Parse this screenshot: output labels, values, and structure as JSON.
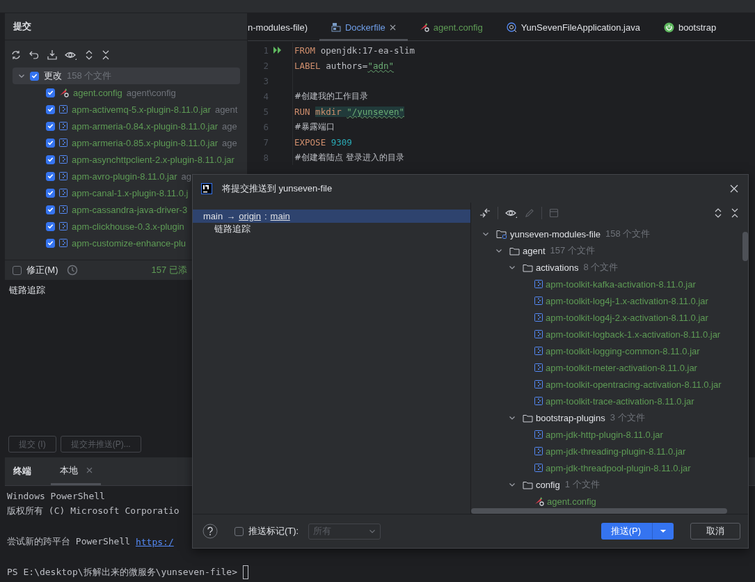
{
  "commit_panel": {
    "title": "提交",
    "changes": {
      "label": "更改",
      "count": "158 个文件",
      "checked": true,
      "expanded": true,
      "files": [
        {
          "name": "agent.config",
          "path": "agent\\config",
          "kind": "config",
          "checked": true
        },
        {
          "name": "apm-activemq-5.x-plugin-8.11.0.jar",
          "path": "agent",
          "kind": "jar",
          "checked": true
        },
        {
          "name": "apm-armeria-0.84.x-plugin-8.11.0.jar",
          "path": "age",
          "kind": "jar",
          "checked": true
        },
        {
          "name": "apm-armeria-0.85.x-plugin-8.11.0.jar",
          "path": "age",
          "kind": "jar",
          "checked": true
        },
        {
          "name": "apm-asynchttpclient-2.x-plugin-8.11.0.jar",
          "kind": "jar",
          "checked": true
        },
        {
          "name": "apm-avro-plugin-8.11.0.jar",
          "path": "ag",
          "kind": "jar",
          "checked": true
        },
        {
          "name": "apm-canal-1.x-plugin-8.11.0.j",
          "kind": "jar",
          "checked": true
        },
        {
          "name": "apm-cassandra-java-driver-3",
          "kind": "jar",
          "checked": true
        },
        {
          "name": "apm-clickhouse-0.3.x-plugin",
          "kind": "jar",
          "checked": true
        },
        {
          "name": "apm-customize-enhance-plu",
          "kind": "jar",
          "checked": true
        }
      ]
    },
    "amend": {
      "label": "修正(M)",
      "checked": false
    },
    "added_note": "157 已添",
    "message": "链路追踪",
    "buttons": [
      {
        "label": "提交 (I)",
        "disabled": true
      },
      {
        "label": "提交并推送(P)...",
        "disabled": true
      }
    ]
  },
  "editor": {
    "tabs": [
      {
        "label": "n-modules-file)",
        "kind": "partial",
        "color": "#dfe1e5",
        "selected": false
      },
      {
        "label": "Dockerfile",
        "kind": "docker",
        "color": "#6f9ee8",
        "selected": true,
        "closable": true
      },
      {
        "label": "agent.config",
        "kind": "config",
        "color": "#5e9b55",
        "selected": false
      },
      {
        "label": "YunSevenFileApplication.java",
        "kind": "java",
        "color": "#dfe1e5",
        "selected": false
      },
      {
        "label": "bootstrap",
        "kind": "spring",
        "color": "#dfe1e5",
        "selected": false
      }
    ],
    "lines": [
      {
        "number": "1",
        "run": true,
        "tokens": [
          {
            "kind": "keyword",
            "text": "FROM "
          },
          {
            "kind": "plain",
            "text": "openjdk:17-ea-slim"
          }
        ]
      },
      {
        "number": "2",
        "tokens": [
          {
            "kind": "keyword",
            "text": "LABEL "
          },
          {
            "kind": "plain",
            "text": "authors="
          },
          {
            "kind": "string",
            "text": "\"adn\""
          }
        ]
      },
      {
        "number": "3"
      },
      {
        "number": "4",
        "tokens": [
          {
            "kind": "comment",
            "text": "#创建我的工作目录"
          }
        ]
      },
      {
        "number": "5",
        "highlight": true,
        "tokens": [
          {
            "kind": "keyword",
            "text": "RUN "
          },
          {
            "kind": "command",
            "text": "mkdir "
          },
          {
            "kind": "string",
            "text": "\"/yunseven\""
          }
        ]
      },
      {
        "number": "6",
        "tokens": [
          {
            "kind": "comment",
            "text": "#暴露端口"
          }
        ]
      },
      {
        "number": "7",
        "tokens": [
          {
            "kind": "keyword",
            "text": "EXPOSE "
          },
          {
            "kind": "number",
            "text": "9309"
          }
        ]
      },
      {
        "number": "8",
        "tokens": [
          {
            "kind": "comment",
            "text": "#创建着陆点 登录进入的目录"
          }
        ]
      }
    ]
  },
  "terminal": {
    "title": "终端",
    "tabs": [
      {
        "label": "本地",
        "selected": true,
        "closable": true
      }
    ],
    "lines": [
      {
        "kind": "text",
        "text": "Windows PowerShell"
      },
      {
        "kind": "text",
        "text": "版权所有 (C) Microsoft Corporatio"
      },
      {
        "kind": "blank"
      },
      {
        "kind": "text",
        "text": "尝试新的跨平台 PowerShell ",
        "link": "https:/"
      },
      {
        "kind": "blank"
      },
      {
        "kind": "prompt",
        "text": "PS E:\\desktop\\拆解出来的微服务\\yunseven-file>"
      }
    ]
  },
  "push_dialog": {
    "title": "将提交推送到 yunseven-file",
    "pushes": [
      {
        "local": "main",
        "arrow": "→",
        "remote": "origin",
        "separator": ":",
        "branch": "main",
        "selected": true,
        "commits": [
          "链路追踪"
        ]
      }
    ],
    "tree": [
      {
        "name": "yunseven-modules-file",
        "count": "158 个文件",
        "kind": "module",
        "expanded": true,
        "children": [
          {
            "name": "agent",
            "count": "157 个文件",
            "kind": "folder",
            "expanded": true,
            "children": [
              {
                "name": "activations",
                "count": "8 个文件",
                "kind": "folder",
                "expanded": true,
                "children": [
                  {
                    "name": "apm-toolkit-kafka-activation-8.11.0.jar",
                    "kind": "jar"
                  },
                  {
                    "name": "apm-toolkit-log4j-1.x-activation-8.11.0.jar",
                    "kind": "jar"
                  },
                  {
                    "name": "apm-toolkit-log4j-2.x-activation-8.11.0.jar",
                    "kind": "jar"
                  },
                  {
                    "name": "apm-toolkit-logback-1.x-activation-8.11.0.jar",
                    "kind": "jar"
                  },
                  {
                    "name": "apm-toolkit-logging-common-8.11.0.jar",
                    "kind": "jar"
                  },
                  {
                    "name": "apm-toolkit-meter-activation-8.11.0.jar",
                    "kind": "jar"
                  },
                  {
                    "name": "apm-toolkit-opentracing-activation-8.11.0.jar",
                    "kind": "jar"
                  },
                  {
                    "name": "apm-toolkit-trace-activation-8.11.0.jar",
                    "kind": "jar"
                  }
                ]
              },
              {
                "name": "bootstrap-plugins",
                "count": "3 个文件",
                "kind": "folder",
                "expanded": true,
                "children": [
                  {
                    "name": "apm-jdk-http-plugin-8.11.0.jar",
                    "kind": "jar"
                  },
                  {
                    "name": "apm-jdk-threading-plugin-8.11.0.jar",
                    "kind": "jar"
                  },
                  {
                    "name": "apm-jdk-threadpool-plugin-8.11.0.jar",
                    "kind": "jar"
                  }
                ]
              },
              {
                "name": "config",
                "count": "1 个文件",
                "kind": "folder",
                "expanded": true,
                "children": [
                  {
                    "name": "agent.config",
                    "kind": "config"
                  }
                ]
              }
            ]
          }
        ]
      }
    ],
    "push_tags": {
      "label": "推送标记(T):",
      "checked": false
    },
    "tag_select": {
      "value": "所有",
      "disabled": true
    },
    "push_button": {
      "label": "推送(P)"
    },
    "cancel_button": {
      "label": "取消"
    }
  }
}
